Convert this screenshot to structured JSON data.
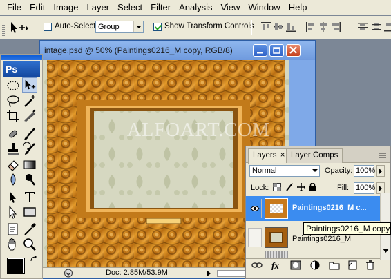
{
  "menu": [
    "File",
    "Edit",
    "Image",
    "Layer",
    "Select",
    "Filter",
    "Analysis",
    "View",
    "Window",
    "Help"
  ],
  "options": {
    "auto_select_label": "Auto-Select:",
    "auto_select_checked": false,
    "auto_select_value": "Group",
    "transform_label": "Show Transform Controls",
    "transform_checked": true
  },
  "toolbox": {
    "logo": "Ps"
  },
  "document": {
    "title": "intage.psd @ 50% (Paintings0216_M copy, RGB/8)",
    "watermark": "ALFOART.COM",
    "status": "Doc: 2.85M/53.9M"
  },
  "layers_panel": {
    "tabs": [
      "Layers",
      "Layer Comps"
    ],
    "tab_close": "×",
    "blend_mode": "Normal",
    "opacity_label": "Opacity:",
    "opacity_value": "100%",
    "lock_label": "Lock:",
    "fill_label": "Fill:",
    "fill_value": "100%",
    "layers": [
      {
        "name": "Paintings0216_M c...",
        "selected": true,
        "visible": true
      },
      {
        "name": "Paintings0216_M",
        "selected": false,
        "visible": false
      }
    ],
    "tooltip": "Paintings0216_M copy"
  },
  "colors": {
    "selection": "#3b8cf0",
    "chrome": "#ece9d8",
    "title_blue": "#0a5bd6"
  }
}
